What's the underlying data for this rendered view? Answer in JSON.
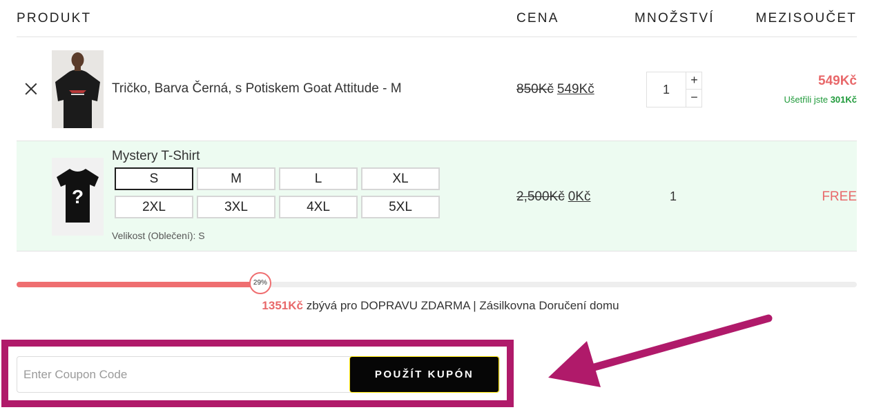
{
  "table_header": {
    "product": "PRODUKT",
    "price": "CENA",
    "quantity": "MNOŽSTVÍ",
    "subtotal": "MEZISOUČET"
  },
  "items": [
    {
      "name": "Tričko, Barva Černá, s Potiskem Goat Attitude - M",
      "price_old": "850Kč",
      "price_new": "549Kč",
      "quantity": "1",
      "subtotal": "549Kč",
      "saved_prefix": "Ušetřili jste",
      "saved_amount": "301Kč",
      "qty_plus": "+",
      "qty_minus": "−"
    },
    {
      "name": "Mystery T-Shirt",
      "sizes": [
        "S",
        "M",
        "L",
        "XL",
        "2XL",
        "3XL",
        "4XL",
        "5XL"
      ],
      "selected_size": "S",
      "variant_label": "Velikost (Oblečení):",
      "variant_value": "S",
      "price_old": "2,500Kč",
      "price_new": "0Kč",
      "quantity": "1",
      "subtotal": "FREE",
      "image_glyph": "?"
    }
  ],
  "shipping_progress": {
    "percent": 29,
    "percent_label": "29%",
    "remaining_amount": "1351Kč",
    "message": "zbývá pro DOPRAVU ZDARMA | Zásilkovna Doručení domu"
  },
  "coupon": {
    "placeholder": "Enter Coupon Code",
    "button_label": "POUŽÍT KUPÓN"
  },
  "colors": {
    "accent": "#e8686a",
    "saved_green": "#1f9a3a",
    "highlight_frame": "#b01a6a",
    "free_row_bg": "#edfbf1"
  }
}
